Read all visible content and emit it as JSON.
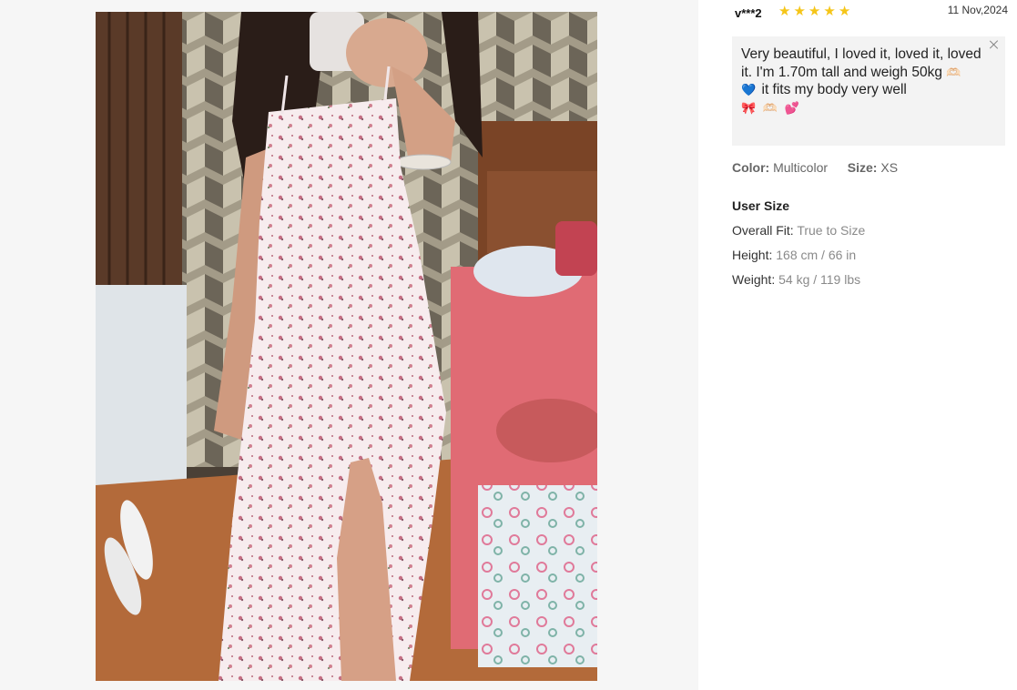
{
  "review": {
    "username": "v***2",
    "rating": 5,
    "date": "11 Nov,2024",
    "text": "Very beautiful, I loved it, loved it, loved it. I'm 1.70m tall and weigh 50kg",
    "text_mid": "it fits my body very well",
    "emoji_1": "🫶🏻 💙",
    "emoji_2": "🎀 🫶🏻 💕",
    "color_label": "Color:",
    "color_value": "Multicolor",
    "size_label": "Size:",
    "size_value": "XS"
  },
  "user_size": {
    "title": "User Size",
    "rows": [
      {
        "label": "Overall Fit:",
        "value": "True to Size"
      },
      {
        "label": "Height:",
        "value": "168 cm / 66 in"
      },
      {
        "label": "Weight:",
        "value": "54 kg / 119 lbs"
      }
    ]
  },
  "icons": {
    "close": "close-icon",
    "star": "star-icon"
  },
  "colors": {
    "star": "#f5c518",
    "review_bg": "#f3f3f3",
    "gallery_bg": "#f6f6f6"
  }
}
